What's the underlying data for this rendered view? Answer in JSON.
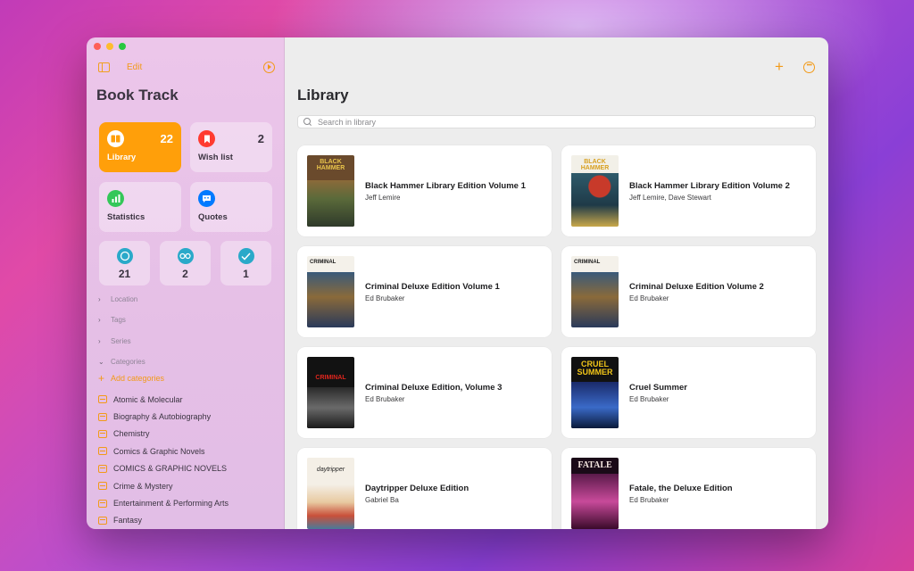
{
  "sidebar": {
    "edit_label": "Edit",
    "app_title": "Book Track",
    "tiles": [
      {
        "label": "Library",
        "count": "22",
        "color": "#ff9f0a"
      },
      {
        "label": "Wish list",
        "count": "2",
        "color": "#ff3b30"
      },
      {
        "label": "Statistics",
        "count": "",
        "color": "#34c759"
      },
      {
        "label": "Quotes",
        "count": "",
        "color": "#007aff"
      }
    ],
    "status_tiles": [
      {
        "count": "21",
        "icon": "circle-icon",
        "color": "#2aa9c9"
      },
      {
        "count": "2",
        "icon": "glasses-icon",
        "color": "#2aa9c9"
      },
      {
        "count": "1",
        "icon": "checkmark-icon",
        "color": "#2aa9c9"
      }
    ],
    "sections": [
      "Location",
      "Tags",
      "Series",
      "Categories"
    ],
    "add_categories_label": "Add categories",
    "categories": [
      "Atomic & Molecular",
      "Biography & Autobiography",
      "Chemistry",
      "Comics & Graphic Novels",
      "COMICS & GRAPHIC NOVELS",
      "Crime & Mystery",
      "Entertainment & Performing Arts",
      "Fantasy"
    ]
  },
  "main": {
    "title": "Library",
    "search_placeholder": "Search in library",
    "accent_color": "#f29a18",
    "books": [
      {
        "title": "Black Hammer Library Edition Volume 1",
        "author": "Jeff Lemire",
        "cover_text": "BLACK HAMMER"
      },
      {
        "title": "Black Hammer Library Edition Volume 2",
        "author": "Jeff Lemire, Dave Stewart",
        "cover_text": "BLACK HAMMER"
      },
      {
        "title": "Criminal Deluxe Edition Volume 1",
        "author": "Ed Brubaker",
        "cover_text": "CRIMINAL"
      },
      {
        "title": "Criminal Deluxe Edition Volume 2",
        "author": "Ed Brubaker",
        "cover_text": "CRIMINAL"
      },
      {
        "title": "Criminal Deluxe Edition, Volume 3",
        "author": "Ed Brubaker",
        "cover_text": "CRIMINAL"
      },
      {
        "title": "Cruel Summer",
        "author": "Ed Brubaker",
        "cover_text": "CRUEL SUMMER"
      },
      {
        "title": "Daytripper Deluxe Edition",
        "author": "Gabriel Ba",
        "cover_text": "daytripper"
      },
      {
        "title": "Fatale, the Deluxe Edition",
        "author": "Ed Brubaker",
        "cover_text": "FATALE"
      }
    ]
  }
}
